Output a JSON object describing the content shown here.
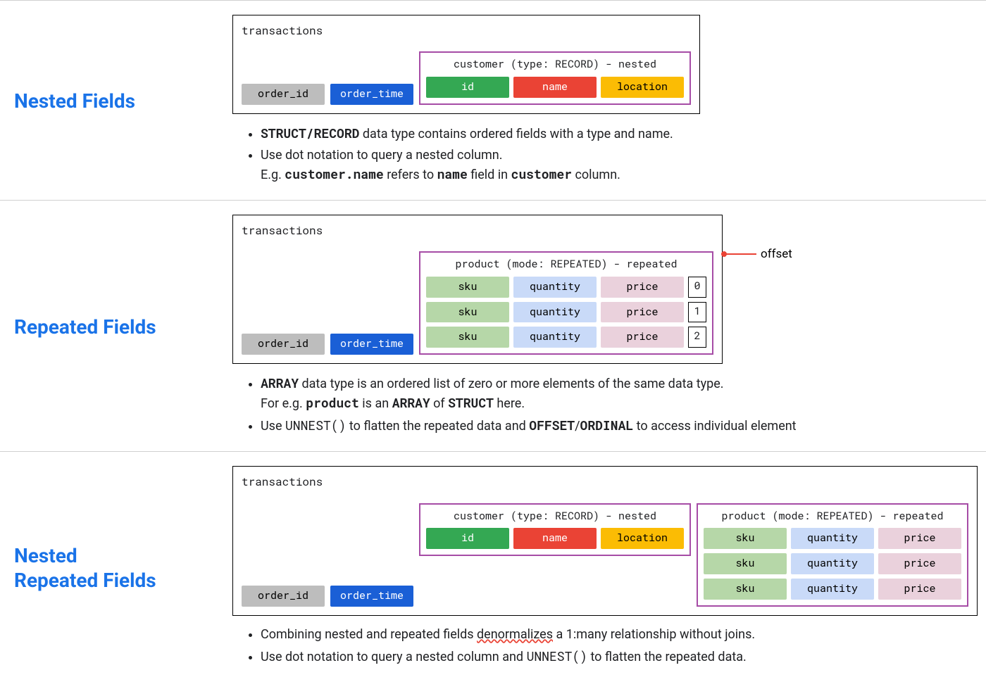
{
  "sections": [
    {
      "title": "Nested Fields",
      "diagram": {
        "table_name": "transactions",
        "base_cols": [
          "order_id",
          "order_time"
        ],
        "nested_label": "customer (type: RECORD) - nested",
        "nested_cols": [
          "id",
          "name",
          "location"
        ]
      },
      "bullets": [
        {
          "type": "struct",
          "b1": "STRUCT/RECORD",
          "t1": " data type contains ordered fields with a type and name."
        },
        {
          "type": "dot",
          "t1": "Use dot notation to query a nested column.",
          "t2": "E.g. ",
          "b2": "customer.name",
          "t3": " refers to ",
          "b3": "name",
          "t4": " field in ",
          "b4": "customer",
          "t5": " column."
        }
      ]
    },
    {
      "title": "Repeated Fields",
      "diagram": {
        "table_name": "transactions",
        "base_cols": [
          "order_id",
          "order_time"
        ],
        "repeated_label": "product (mode: REPEATED) - repeated",
        "repeated_cols": [
          "sku",
          "quantity",
          "price"
        ],
        "offsets": [
          "0",
          "1",
          "2"
        ],
        "callout": "offset"
      },
      "bullets": [
        {
          "type": "array",
          "b1": "ARRAY",
          "t1": " data type is an ordered list of zero or more elements of the same data type.",
          "t2": "For e.g. ",
          "b2": "product",
          "t3": " is an ",
          "b3": "ARRAY",
          "t4": " of ",
          "b4": "STRUCT",
          "t5": " here."
        },
        {
          "type": "unnest",
          "t1": "Use ",
          "m1": "UNNEST()",
          "t2": " to flatten the repeated data and ",
          "b1": "OFFSET",
          "t3": "/",
          "b2": "ORDINAL",
          "t4": " to access individual element"
        }
      ]
    },
    {
      "title": "Nested\nRepeated Fields",
      "diagram": {
        "table_name": "transactions",
        "base_cols": [
          "order_id",
          "order_time"
        ],
        "nested_label": "customer (type: RECORD) - nested",
        "nested_cols": [
          "id",
          "name",
          "location"
        ],
        "repeated_label": "product (mode: REPEATED) - repeated",
        "repeated_cols": [
          "sku",
          "quantity",
          "price"
        ],
        "repeat_rows": 3
      },
      "bullets": [
        {
          "type": "combine",
          "t1": "Combining nested and repeated fields ",
          "s1": "denormalizes",
          "t2": " a 1:many relationship without joins."
        },
        {
          "type": "both",
          "t1": "Use dot notation to query a nested column and ",
          "m1": "UNNEST()",
          "t2": " to flatten the repeated data."
        }
      ]
    }
  ]
}
